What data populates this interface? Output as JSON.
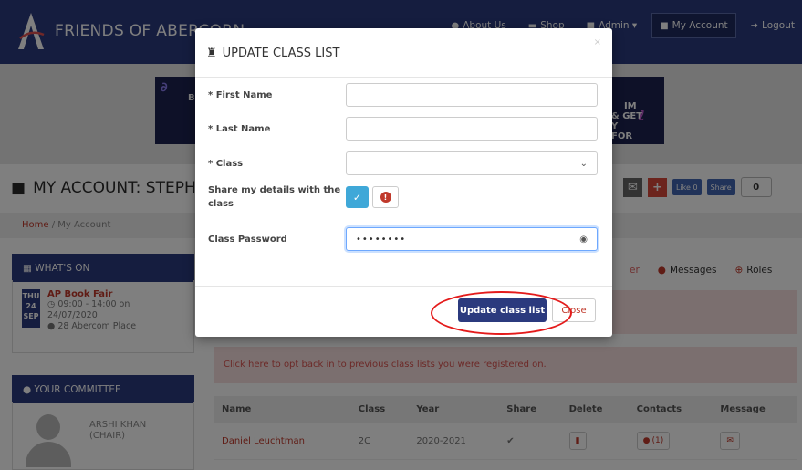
{
  "nav": {
    "brand": "FRIENDS OF ABERCORN",
    "links": [
      {
        "label": "About Us",
        "icon": "info-icon"
      },
      {
        "label": "Shop",
        "icon": "cart-icon"
      },
      {
        "label": "Admin ▾",
        "icon": "lock-icon"
      },
      {
        "label": "My Account",
        "icon": "briefcase-icon"
      },
      {
        "label": "Logout",
        "icon": "logout-icon"
      }
    ]
  },
  "banner": {
    "left_ad": "BU",
    "right_ad": "IM\n& GET\nY\nFOR"
  },
  "page": {
    "title": "MY ACCOUNT: STEPH",
    "fb_like": "Like 0",
    "fb_share": "Share",
    "share_count": "0"
  },
  "breadcrumb": {
    "home": "Home",
    "separator": "/",
    "current": "My Account"
  },
  "whats_on": {
    "heading": "WHAT'S ON",
    "date": {
      "weekday": "THU",
      "day": "24",
      "month": "SEP"
    },
    "event_title": "AP Book Fair",
    "time": "09:00 - 14:00 on",
    "date_text": "24/07/2020",
    "location": "28 Abercom Place"
  },
  "committee": {
    "heading": "YOUR COMMITTEE",
    "member_name": "ARSHI KHAN",
    "member_role": "(CHAIR)"
  },
  "tabs": {
    "fragment": "er",
    "messages": "Messages",
    "roles": "Roles"
  },
  "optback_text": "Click here to opt back in to previous class lists you were registered on.",
  "table": {
    "headers": [
      "Name",
      "Class",
      "Year",
      "Share",
      "Delete",
      "Contacts",
      "Message"
    ],
    "rows": [
      {
        "name": "Daniel Leuchtman",
        "class": "2C",
        "year": "2020-2021",
        "share": "✔",
        "contacts": "(1)"
      }
    ]
  },
  "modal": {
    "title": "UPDATE CLASS LIST",
    "close_x": "×",
    "fields": {
      "first_name_label": "* First Name",
      "first_name_value": "",
      "last_name_label": "* Last Name",
      "last_name_value": "",
      "class_label": "* Class",
      "class_value": "",
      "share_label": "Share my details with the class",
      "password_label": "Class Password",
      "password_value": "••••••••"
    },
    "update_button": "Update class list",
    "close_button": "Close"
  },
  "colors": {
    "navy": "#2b3a7e",
    "accent_red": "#c0392b",
    "toggle_blue": "#3fa8d8",
    "highlight_ring": "#e41b1b"
  }
}
